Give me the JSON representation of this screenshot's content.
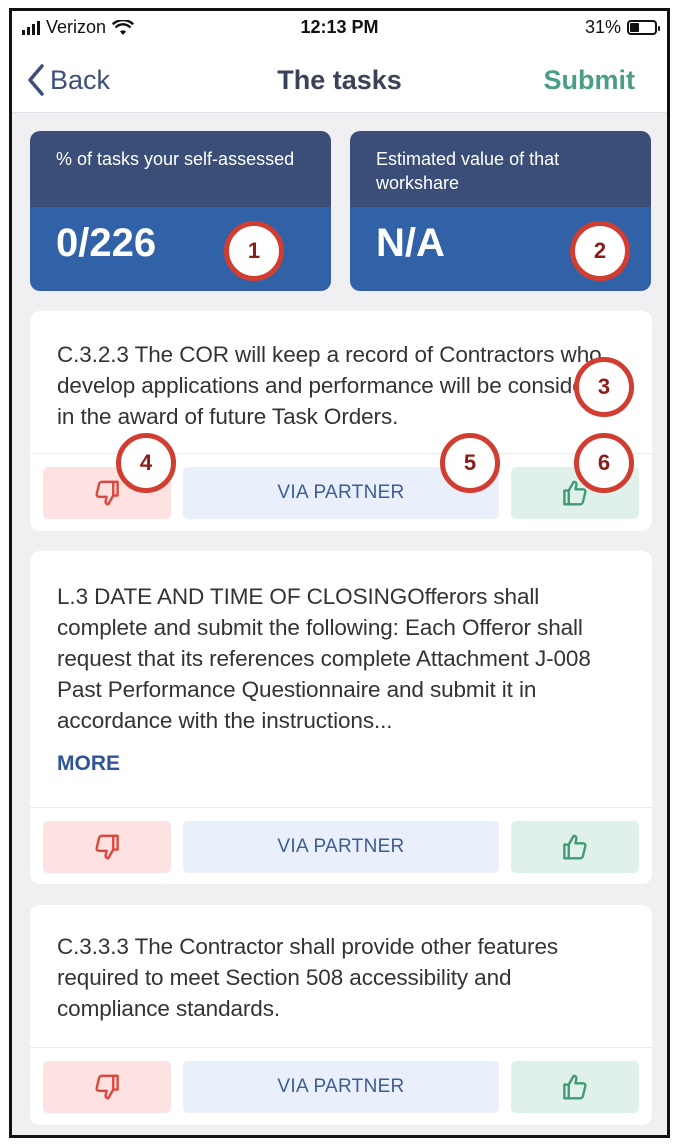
{
  "status_bar": {
    "carrier": "Verizon",
    "time": "12:13 PM",
    "battery": "31%"
  },
  "nav": {
    "back_label": "Back",
    "title": "The tasks",
    "submit_label": "Submit"
  },
  "stats": [
    {
      "label": "% of tasks your self-assessed",
      "value": "0/226"
    },
    {
      "label": "Estimated value of that workshare",
      "value": "N/A"
    }
  ],
  "markers": [
    "1",
    "2",
    "3",
    "4",
    "5",
    "6"
  ],
  "tasks": [
    {
      "text": "C.3.2.3 The COR will keep a record of Contractors who develop applications and performance will be considered in the award of future Task Orders.",
      "partner_label": "VIA PARTNER"
    },
    {
      "text": "L.3 DATE AND TIME OF CLOSINGOfferors shall complete and submit the following: Each Offeror shall request that its references complete Attachment J-008 Past Performance Questionnaire and submit it in accordance with the instructions...",
      "more_label": "MORE",
      "partner_label": "VIA PARTNER"
    },
    {
      "text": "C.3.3.3 The Contractor shall provide other features required to meet Section 508 accessibility and compliance standards.",
      "partner_label": "VIA PARTNER"
    }
  ],
  "icons": {
    "thumbs_down": "thumbs-down-icon",
    "thumbs_up": "thumbs-up-icon",
    "back": "chevron-left-icon"
  },
  "colors": {
    "down": "#e0443b",
    "up": "#3f9b74",
    "accent": "#4a9e86",
    "stat_head": "#3a4e78",
    "stat_value": "#3162a8"
  }
}
